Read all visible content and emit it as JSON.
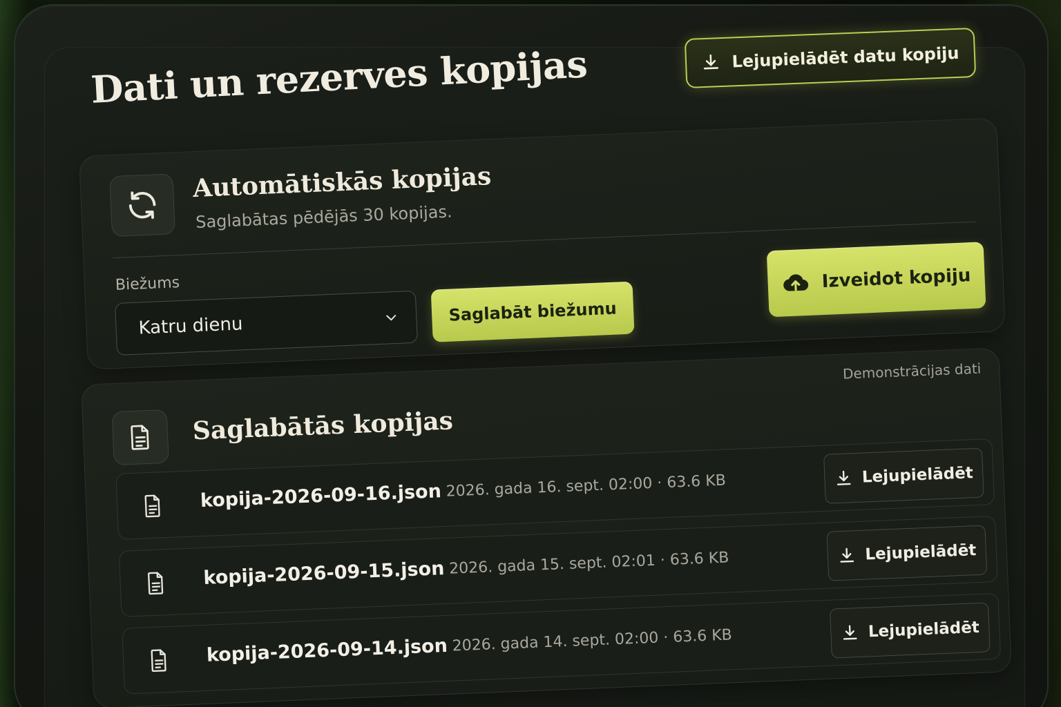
{
  "page": {
    "title": "Dati un rezerves kopijas",
    "download_all_label": "Lejupielādēt datu kopiju"
  },
  "auto": {
    "title": "Automātiskās kopijas",
    "subtitle": "Saglabātas pēdējās 30 kopijas.",
    "frequency_label": "Biežums",
    "frequency_value": "Katru dienu",
    "save_frequency_label": "Saglabāt biežumu",
    "create_backup_label": "Izveidot kopiju",
    "icons": {
      "section": "sync-icon",
      "create": "cloud-upload-icon"
    }
  },
  "saved": {
    "title": "Saglabātās kopijas",
    "demo_label": "Demonstrācijas dati",
    "separator": "·",
    "download_label": "Lejupielādēt",
    "items": [
      {
        "name": "kopija-2026-09-16.json",
        "date": "2026. gada 16. sept.",
        "time": "02:00",
        "size": "63.6 KB"
      },
      {
        "name": "kopija-2026-09-15.json",
        "date": "2026. gada 15. sept.",
        "time": "02:01",
        "size": "63.6 KB"
      },
      {
        "name": "kopija-2026-09-14.json",
        "date": "2026. gada 14. sept.",
        "time": "02:00",
        "size": "63.6 KB"
      }
    ]
  },
  "colors": {
    "accent": "#c8d65a",
    "background": "#161a15",
    "text": "#f1ece0"
  }
}
